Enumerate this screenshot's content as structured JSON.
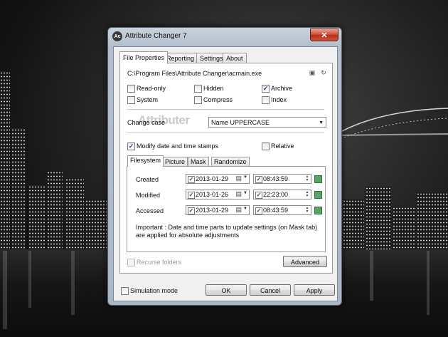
{
  "window": {
    "title": "Attribute Changer 7",
    "icon_text": "Ac",
    "close_glyph": "✕"
  },
  "tabs": [
    "File Properties",
    "Reporting",
    "Settings",
    "About"
  ],
  "file_path": "C:\\Program Files\\Attribute Changer\\acmain.exe",
  "watermark": "Attributer",
  "attributes": [
    {
      "label": "Read-only",
      "checked": false
    },
    {
      "label": "Hidden",
      "checked": false
    },
    {
      "label": "Archive",
      "checked": true
    },
    {
      "label": "System",
      "checked": false
    },
    {
      "label": "Compress",
      "checked": false
    },
    {
      "label": "Index",
      "checked": false
    }
  ],
  "change_case": {
    "label": "Change case",
    "value": "Name UPPERCASE"
  },
  "modify_dates": {
    "label": "Modify date and time stamps",
    "checked": true
  },
  "relative": {
    "label": "Relative",
    "checked": false
  },
  "inner_tabs": [
    "Filesystem",
    "Picture",
    "Mask",
    "Randomize"
  ],
  "timestamps": [
    {
      "label": "Created",
      "date": "2013-01-29",
      "time": "08:43:59"
    },
    {
      "label": "Modified",
      "date": "2013-01-26",
      "time": "22:23:00"
    },
    {
      "label": "Accessed",
      "date": "2013-01-29",
      "time": "08:43:59"
    }
  ],
  "note": "Important : Date and time parts to update settings (on Mask tab) are applied for absolute adjustments",
  "recurse": {
    "label": "Recurse folders",
    "checked": false
  },
  "advanced_label": "Advanced",
  "simulation": {
    "label": "Simulation mode",
    "checked": false
  },
  "buttons": {
    "ok": "OK",
    "cancel": "Cancel",
    "apply": "Apply"
  },
  "check_glyph": "✓",
  "colors": {
    "accent_green": "#5aa36a",
    "close_red": "#c8452e"
  },
  "icons": {
    "copy": "copy-icon",
    "refresh": "refresh-icon",
    "calendar": "calendar-icon",
    "grid": "grid-icon"
  }
}
